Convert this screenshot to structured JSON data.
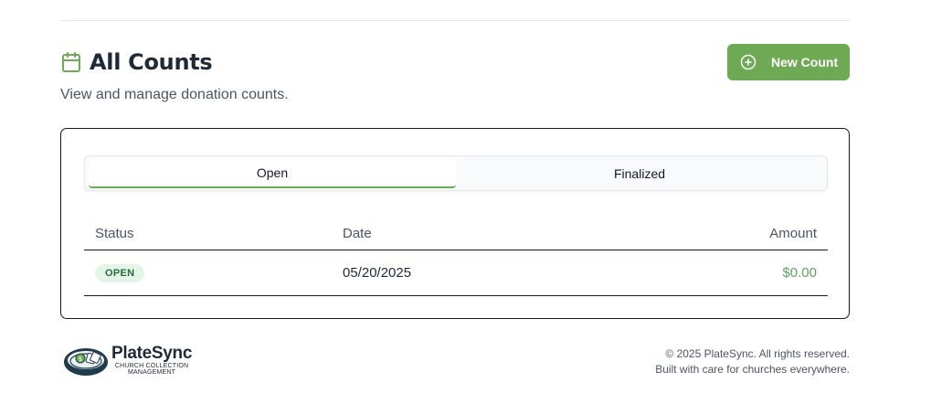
{
  "page": {
    "title": "All Counts",
    "subtitle": "View and manage donation counts.",
    "new_button_label": "New Count"
  },
  "tabs": [
    {
      "label": "Open",
      "active": true
    },
    {
      "label": "Finalized",
      "active": false
    }
  ],
  "table": {
    "headers": {
      "status": "Status",
      "date": "Date",
      "amount": "Amount"
    },
    "rows": [
      {
        "status": "OPEN",
        "date": "05/20/2025",
        "amount": "$0.00"
      }
    ]
  },
  "footer": {
    "brand_name": "PlateSync",
    "brand_tagline_1": "CHURCH COLLECTION",
    "brand_tagline_2": "MANAGEMENT",
    "copyright": "© 2025 PlateSync. All rights reserved.",
    "tagline": "Built with care for churches everywhere."
  },
  "colors": {
    "accent": "#6ea953",
    "badge_bg": "#e3f5e8",
    "badge_text": "#276b3c",
    "amount_text": "#5aa365"
  },
  "icons": {
    "title_icon": "calendar-icon",
    "button_icon": "plus-circle-icon",
    "logo": "platesync-logo"
  }
}
